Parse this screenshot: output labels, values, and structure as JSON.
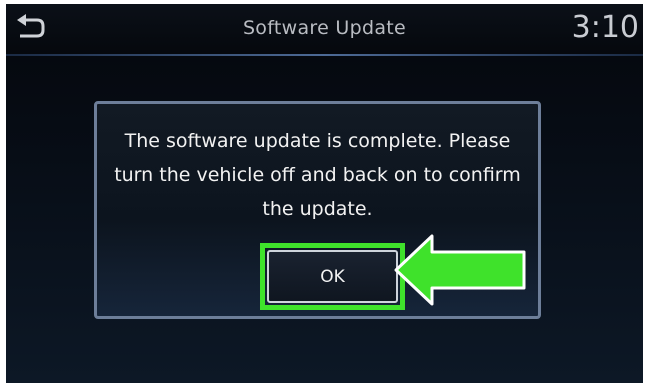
{
  "header": {
    "title": "Software Update",
    "clock": "3:10",
    "back_icon": "back-arrow-icon"
  },
  "dialog": {
    "message": "The software update is complete. Please turn the vehicle off and back on to confirm the update.",
    "ok_label": "OK"
  },
  "annotation": {
    "arrow_icon": "pointer-arrow",
    "highlight_color": "#3fe22b",
    "arrow_color": "#3fe22b"
  },
  "colors": {
    "background": "#070d16",
    "dialog_border": "#6d7e99",
    "text": "#f2f2f2"
  }
}
